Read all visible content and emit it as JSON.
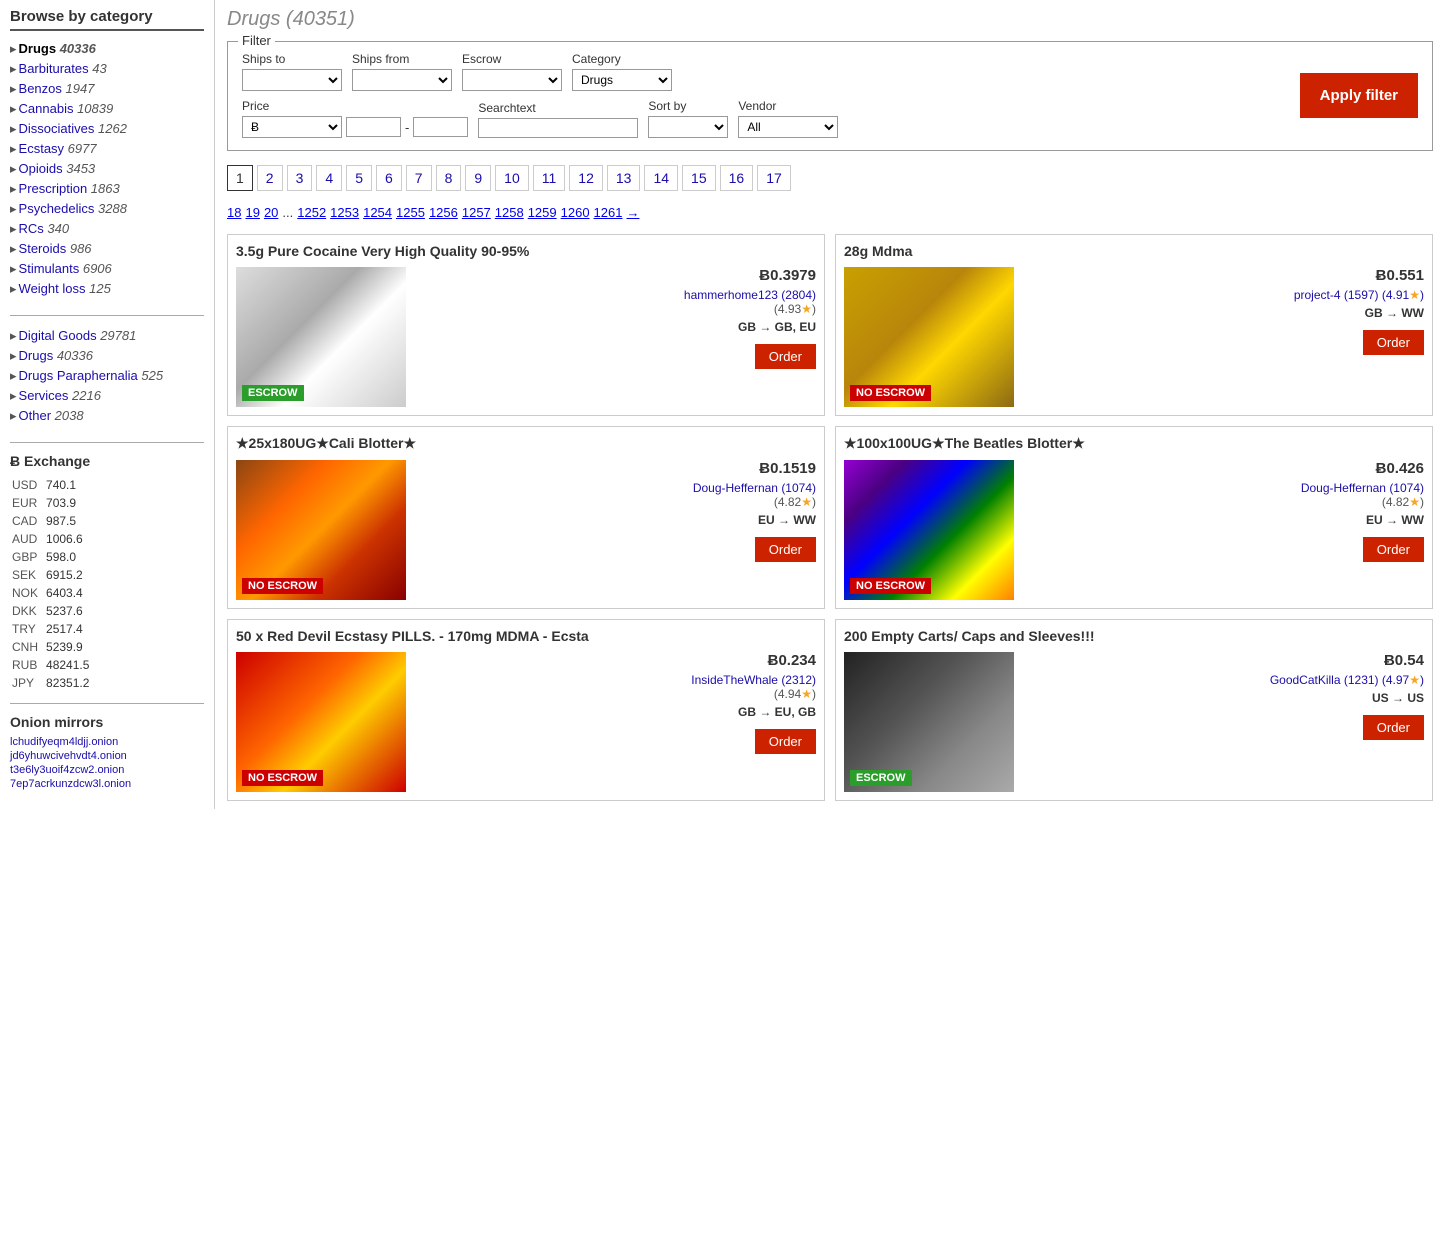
{
  "sidebar": {
    "browse_title": "Browse by category",
    "categories_main": [
      {
        "label": "Drugs",
        "count": "40336",
        "active": true,
        "bullet": "▸"
      },
      {
        "label": "Barbiturates",
        "count": "43",
        "active": false,
        "bullet": "▸"
      },
      {
        "label": "Benzos",
        "count": "1947",
        "active": false,
        "bullet": "▸"
      },
      {
        "label": "Cannabis",
        "count": "10839",
        "active": false,
        "bullet": "▸"
      },
      {
        "label": "Dissociatives",
        "count": "1262",
        "active": false,
        "bullet": "▸"
      },
      {
        "label": "Ecstasy",
        "count": "6977",
        "active": false,
        "bullet": "▸"
      },
      {
        "label": "Opioids",
        "count": "3453",
        "active": false,
        "bullet": "▸"
      },
      {
        "label": "Prescription",
        "count": "1863",
        "active": false,
        "bullet": "▸"
      },
      {
        "label": "Psychedelics",
        "count": "3288",
        "active": false,
        "bullet": "▸"
      },
      {
        "label": "RCs",
        "count": "340",
        "active": false,
        "bullet": "▸"
      },
      {
        "label": "Steroids",
        "count": "986",
        "active": false,
        "bullet": "▸"
      },
      {
        "label": "Stimulants",
        "count": "6906",
        "active": false,
        "bullet": "▸"
      },
      {
        "label": "Weight loss",
        "count": "125",
        "active": false,
        "bullet": "▸"
      }
    ],
    "categories_secondary": [
      {
        "label": "Digital Goods",
        "count": "29781",
        "bullet": "▸"
      },
      {
        "label": "Drugs",
        "count": "40336",
        "bullet": "▸"
      },
      {
        "label": "Drugs Paraphernalia",
        "count": "525",
        "bullet": "▸"
      },
      {
        "label": "Services",
        "count": "2216",
        "bullet": "▸"
      },
      {
        "label": "Other",
        "count": "2038",
        "bullet": "▸"
      }
    ],
    "exchange_title": "Ƀ Exchange",
    "exchange_rates": [
      {
        "currency": "USD",
        "rate": "740.1"
      },
      {
        "currency": "EUR",
        "rate": "703.9"
      },
      {
        "currency": "CAD",
        "rate": "987.5"
      },
      {
        "currency": "AUD",
        "rate": "1006.6"
      },
      {
        "currency": "GBP",
        "rate": "598.0"
      },
      {
        "currency": "SEK",
        "rate": "6915.2"
      },
      {
        "currency": "NOK",
        "rate": "6403.4"
      },
      {
        "currency": "DKK",
        "rate": "5237.6"
      },
      {
        "currency": "TRY",
        "rate": "2517.4"
      },
      {
        "currency": "CNH",
        "rate": "5239.9"
      },
      {
        "currency": "RUB",
        "rate": "48241.5"
      },
      {
        "currency": "JPY",
        "rate": "82351.2"
      }
    ],
    "onion_title": "Onion mirrors",
    "onion_links": [
      "lchudifyeqm4ldjj.onion",
      "jd6yhuwcivehvdt4.onion",
      "t3e6ly3uoif4zcw2.onion",
      "7ep7acrkunzdcw3l.onion"
    ]
  },
  "main": {
    "page_title": "Drugs (40351)",
    "filter": {
      "legend": "Filter",
      "ships_to_label": "Ships to",
      "ships_from_label": "Ships from",
      "escrow_label": "Escrow",
      "category_label": "Category",
      "category_value": "Drugs",
      "price_label": "Price",
      "price_currency": "Ƀ",
      "searchtext_label": "Searchtext",
      "sort_by_label": "Sort by",
      "vendor_label": "Vendor",
      "vendor_value": "All",
      "apply_label": "Apply filter"
    },
    "pagination_row1": [
      "1",
      "2",
      "3",
      "4",
      "5",
      "6",
      "7",
      "8",
      "9",
      "10",
      "11",
      "12",
      "13",
      "14",
      "15",
      "16",
      "17"
    ],
    "pagination_row2": [
      "18",
      "19",
      "20",
      "...",
      "1252",
      "1253",
      "1254",
      "1255",
      "1256",
      "1257",
      "1258",
      "1259",
      "1260",
      "1261"
    ],
    "products": [
      {
        "title": "3.5g Pure Cocaine Very High Quality 90-95%",
        "price": "Ƀ0.3979",
        "vendor": "hammerhome123 (2804)",
        "rating": "(4.93★)",
        "shipping": "GB → GB, EU",
        "escrow": "ESCROW",
        "escrow_type": "green",
        "img_class": "img-cocaine"
      },
      {
        "title": "28g Mdma",
        "price": "Ƀ0.551",
        "vendor": "project-4 (1597) (4.91★)",
        "rating": "",
        "shipping": "GB → WW",
        "escrow": "NO ESCROW",
        "escrow_type": "red",
        "img_class": "img-mdma"
      },
      {
        "title": "★25x180UG★Cali Blotter★",
        "price": "Ƀ0.1519",
        "vendor": "Doug-Heffernan (1074)",
        "rating": "(4.82★)",
        "shipping": "EU → WW",
        "escrow": "NO ESCROW",
        "escrow_type": "red",
        "img_class": "img-blotter1"
      },
      {
        "title": "★100x100UG★The Beatles Blotter★",
        "price": "Ƀ0.426",
        "vendor": "Doug-Heffernan (1074)",
        "rating": "(4.82★)",
        "shipping": "EU → WW",
        "escrow": "NO ESCROW",
        "escrow_type": "red",
        "img_class": "img-blotter2"
      },
      {
        "title": "50 x Red Devil Ecstasy PILLS. - 170mg MDMA - Ecsta",
        "price": "Ƀ0.234",
        "vendor": "InsideTheWhale (2312)",
        "rating": "(4.94★)",
        "shipping": "GB → EU, GB",
        "escrow": "NO ESCROW",
        "escrow_type": "red",
        "img_class": "img-ecstasy"
      },
      {
        "title": "200 Empty Carts/ Caps and Sleeves!!!",
        "price": "Ƀ0.54",
        "vendor": "GoodCatKilla (1231) (4.97★)",
        "rating": "",
        "shipping": "US → US",
        "escrow": "ESCROW",
        "escrow_type": "green",
        "img_class": "img-carts"
      }
    ],
    "order_label": "Order"
  }
}
